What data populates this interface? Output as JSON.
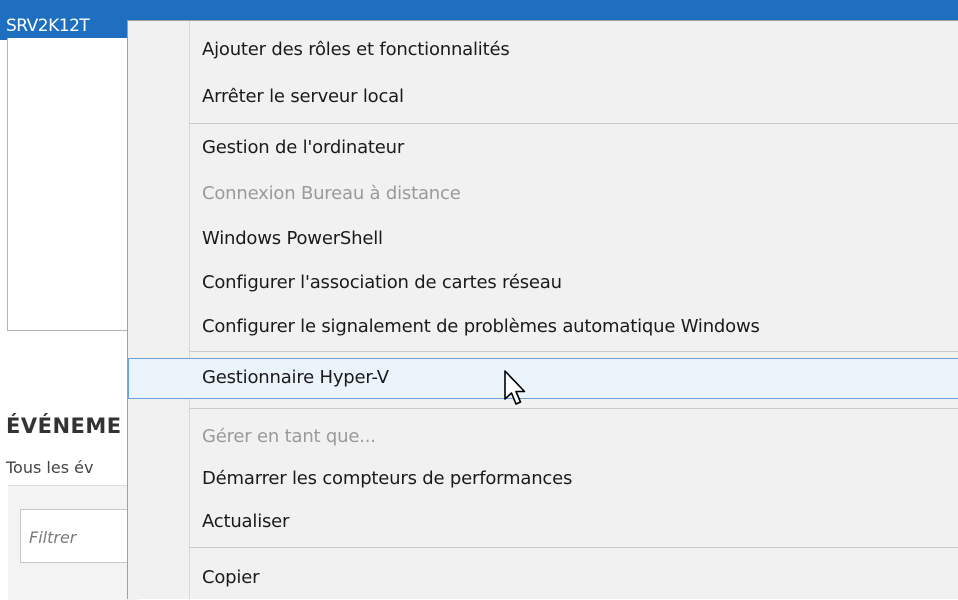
{
  "server": {
    "name": "SRV2K12T"
  },
  "events_section": {
    "title": "ÉVÉNEME",
    "subtitle": "Tous les év",
    "filter_placeholder": "Filtrer"
  },
  "context_menu": {
    "items": [
      {
        "label": "Ajouter des rôles et fonctionnalités",
        "state": "enabled"
      },
      {
        "label": "Arrêter le serveur local",
        "state": "enabled"
      },
      {
        "label": "Gestion de l'ordinateur",
        "state": "enabled"
      },
      {
        "label": "Connexion Bureau à distance",
        "state": "disabled"
      },
      {
        "label": "Windows PowerShell",
        "state": "enabled"
      },
      {
        "label": "Configurer l'association de cartes réseau",
        "state": "enabled"
      },
      {
        "label": "Configurer le signalement de problèmes automatique Windows",
        "state": "enabled"
      },
      {
        "label": "Gestionnaire Hyper-V",
        "state": "hover"
      },
      {
        "label": "Gérer en tant que...",
        "state": "disabled"
      },
      {
        "label": "Démarrer les compteurs de performances",
        "state": "enabled"
      },
      {
        "label": "Actualiser",
        "state": "enabled"
      },
      {
        "label": "Copier",
        "state": "enabled"
      }
    ]
  },
  "colors": {
    "selection_blue": "#1e6fc0",
    "menu_background": "#f1f1f1",
    "hover_border": "#6aa0d6",
    "disabled_text": "#9a9a9a"
  }
}
